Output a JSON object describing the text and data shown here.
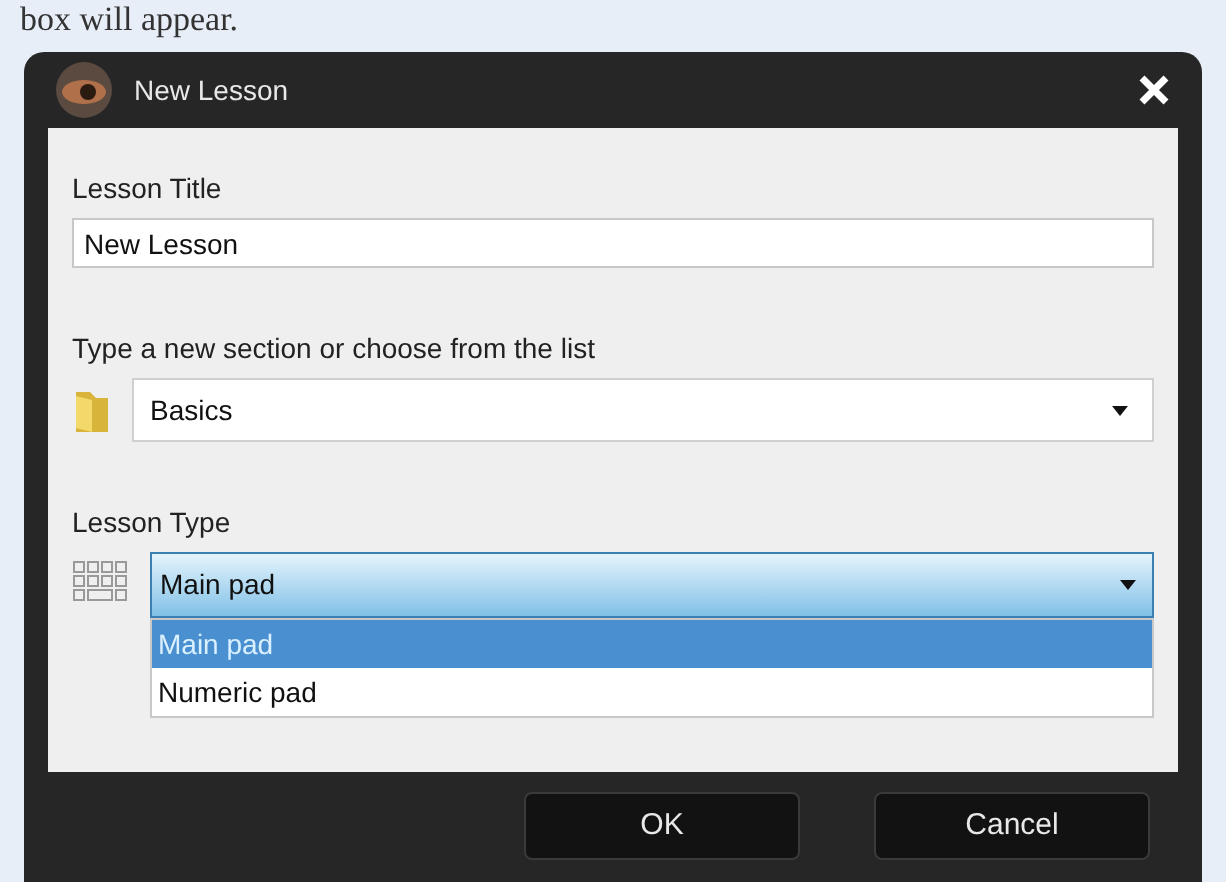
{
  "page_text": "box will appear.",
  "window": {
    "title": "New Lesson"
  },
  "lesson_title": {
    "label": "Lesson Title",
    "value": "New Lesson"
  },
  "section": {
    "label": "Type a new section or choose from the list",
    "value": "Basics"
  },
  "lesson_type": {
    "label": "Lesson Type",
    "value": "Main pad",
    "expanded": true,
    "options": [
      {
        "label": "Main pad",
        "selected": true
      },
      {
        "label": "Numeric pad",
        "selected": false
      }
    ]
  },
  "buttons": [
    "OK",
    "Cancel"
  ]
}
